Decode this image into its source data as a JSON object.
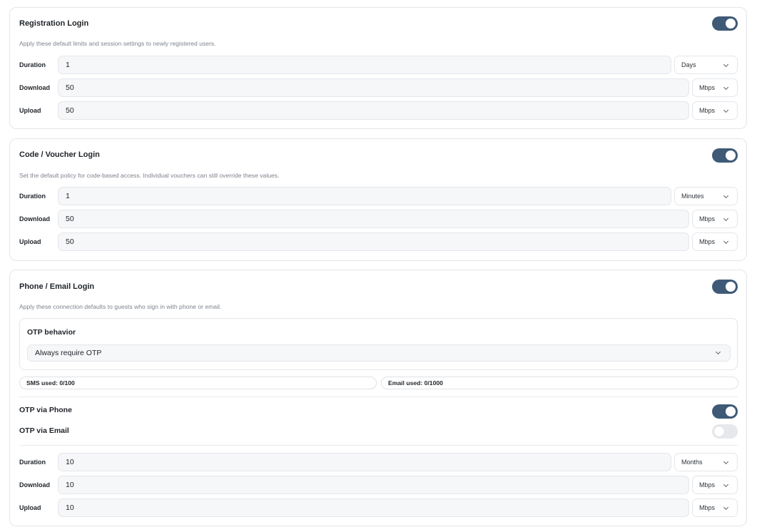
{
  "sections": [
    {
      "title": "Registration Login",
      "description": "Apply these default limits and session settings to newly registered users.",
      "enabled": true,
      "rows": [
        {
          "label": "Duration",
          "value": "1",
          "unit": "Days"
        },
        {
          "label": "Download",
          "value": "50",
          "unit": "Mbps"
        },
        {
          "label": "Upload",
          "value": "50",
          "unit": "Mbps"
        }
      ]
    },
    {
      "title": "Code / Voucher Login",
      "description": "Set the default policy for code-based access. Individual vouchers can still override these values.",
      "enabled": true,
      "rows": [
        {
          "label": "Duration",
          "value": "1",
          "unit": "Minutes"
        },
        {
          "label": "Download",
          "value": "50",
          "unit": "Mbps"
        },
        {
          "label": "Upload",
          "value": "50",
          "unit": "Mbps"
        }
      ]
    },
    {
      "title": "Phone / Email Login",
      "description": "Apply these connection defaults to guests who sign in with phone or email.",
      "enabled": true,
      "otp": {
        "title": "OTP behavior",
        "selected": "Always require OTP"
      },
      "usage": {
        "sms": "SMS used: 0/100",
        "email": "Email used: 0/1000"
      },
      "otp_phone": {
        "label": "OTP via Phone",
        "enabled": true
      },
      "otp_email": {
        "label": "OTP via Email",
        "enabled": false
      },
      "rows": [
        {
          "label": "Duration",
          "value": "10",
          "unit": "Months"
        },
        {
          "label": "Download",
          "value": "10",
          "unit": "Mbps"
        },
        {
          "label": "Upload",
          "value": "10",
          "unit": "Mbps"
        }
      ]
    }
  ],
  "colors": {
    "toggle_on": "#3f5a76",
    "toggle_off": "#e6e8eb",
    "border": "#e4e6ea",
    "field_bg": "#f6f7f9",
    "muted_text": "#7d838c"
  },
  "icons": {
    "dropdown": "chevron-down-icon"
  }
}
